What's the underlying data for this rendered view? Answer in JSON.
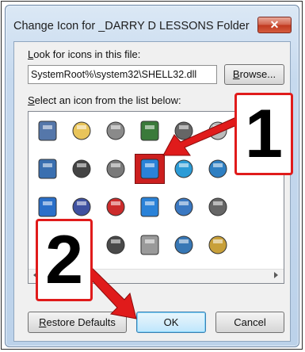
{
  "dialog": {
    "title": "Change Icon for _DARRY D LESSONS Folder",
    "close_label": "✕"
  },
  "look_for": {
    "label_underlined": "L",
    "label_rest": "ook for icons in this file:",
    "path_value": "SystemRoot%\\system32\\SHELL32.dll",
    "browse_underlined": "B",
    "browse_rest": "rowse..."
  },
  "select": {
    "label_underlined": "S",
    "label_rest": "elect an icon from the list below:"
  },
  "icons": [
    {
      "name": "blank-document-icon",
      "color": "#5577aa"
    },
    {
      "name": "folder-icon",
      "color": "#e8c45a"
    },
    {
      "name": "hard-drive-icon",
      "color": "#8a8a8a"
    },
    {
      "name": "memory-chip-icon",
      "color": "#3a7a3a"
    },
    {
      "name": "printer-icon",
      "color": "#666666"
    },
    {
      "name": "cd-drive-icon",
      "color": "#bbbbbb"
    },
    {
      "name": "text-document-icon",
      "color": "#3a6fb0"
    },
    {
      "name": "network-drive-icon",
      "color": "#444444"
    },
    {
      "name": "removable-drive-icon",
      "color": "#7a7a7a"
    },
    {
      "name": "internet-globe-icon",
      "color": "#2a82d8",
      "selected": true
    },
    {
      "name": "network-globe-icon",
      "color": "#2b9bd6"
    },
    {
      "name": "control-panel-icon",
      "color": "#2e7fc2"
    },
    {
      "name": "window-icon",
      "color": "#2a6fc9"
    },
    {
      "name": "floppy-computer-icon",
      "color": "#3f51a0"
    },
    {
      "name": "disconnected-drive-icon",
      "color": "#cc2b2b"
    },
    {
      "name": "globe-cursor-icon",
      "color": "#2a82d8"
    },
    {
      "name": "network-users-icon",
      "color": "#3a78c2"
    },
    {
      "name": "search-icon",
      "color": "#666666"
    },
    {
      "name": "network-share-icon",
      "color": "#3c9b3c"
    },
    {
      "name": "clock-icon",
      "color": "#333333"
    },
    {
      "name": "computer-icon",
      "color": "#4a4a4a"
    },
    {
      "name": "dvd-drive-icon",
      "color": "#9a9a9a"
    },
    {
      "name": "monitor-icon",
      "color": "#3777b5"
    },
    {
      "name": "calculator-icon",
      "color": "#c8a03a"
    },
    {
      "name": "help-icon",
      "color": "#2a6fd1"
    },
    {
      "name": "power-icon",
      "color": "#e25a1c"
    },
    {
      "name": "recycle-bin-icon",
      "color": "#5a8ab5"
    }
  ],
  "buttons": {
    "restore_underlined": "R",
    "restore_rest": "estore Defaults",
    "ok": "OK",
    "cancel": "Cancel"
  },
  "annotations": {
    "callout_1": "1",
    "callout_2": "2",
    "arrow_color": "#e01b1b"
  }
}
